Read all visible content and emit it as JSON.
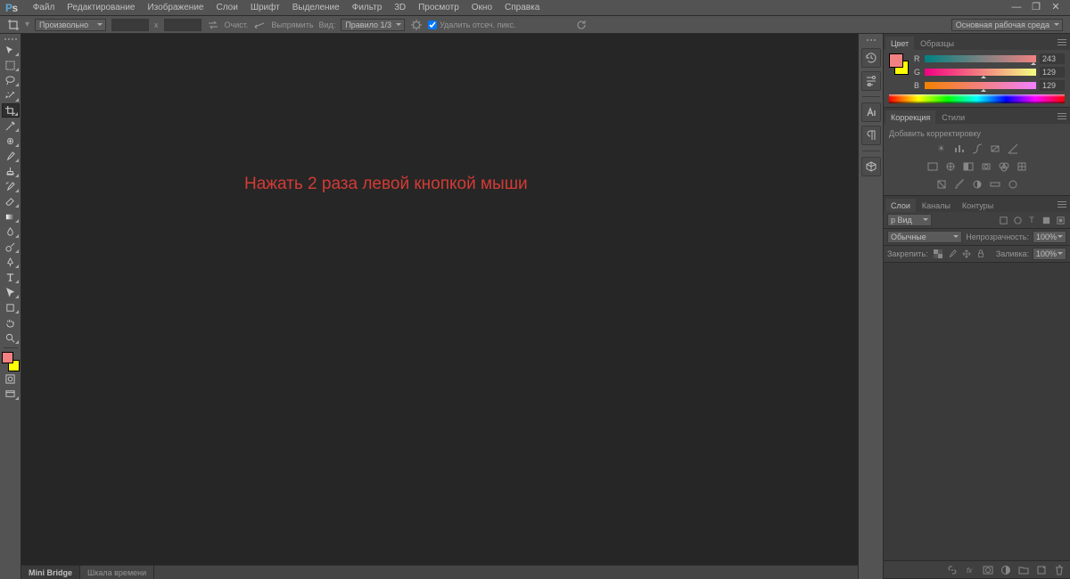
{
  "menubar": {
    "items": [
      "Файл",
      "Редактирование",
      "Изображение",
      "Слои",
      "Шрифт",
      "Выделение",
      "Фильтр",
      "3D",
      "Просмотр",
      "Окно",
      "Справка"
    ]
  },
  "optbar": {
    "aspect_mode": "Произвольно",
    "x_sep": "x",
    "clear_label": "Очист.",
    "straighten": "Выпрямить",
    "view_label": "Вид:",
    "view_mode": "Правило 1/3",
    "delete_pixels": "Удалить отсеч. пикс.",
    "workspace": "Основная рабочая среда"
  },
  "colors": {
    "fg": "#f38181",
    "bg": "#ffff00"
  },
  "color_panel": {
    "tabs": [
      "Цвет",
      "Образцы"
    ],
    "r_label": "R",
    "r_val": "243",
    "g_label": "G",
    "g_val": "129",
    "b_label": "B",
    "b_val": "129"
  },
  "adjustments_panel": {
    "tabs": [
      "Коррекция",
      "Стили"
    ],
    "add_label": "Добавить корректировку"
  },
  "layers_panel": {
    "tabs": [
      "Слои",
      "Каналы",
      "Контуры"
    ],
    "filter_kind": "р Вид",
    "blend_mode": "Обычные",
    "opacity_label": "Непрозрачность:",
    "opacity_val": "100%",
    "lock_label": "Закрепить:",
    "fill_label": "Заливка:",
    "fill_val": "100%"
  },
  "canvas": {
    "instruction": "Нажать 2 раза левой кнопкой мыши"
  },
  "bottom_tabs": {
    "items": [
      "Mini Bridge",
      "Шкала времени"
    ]
  }
}
